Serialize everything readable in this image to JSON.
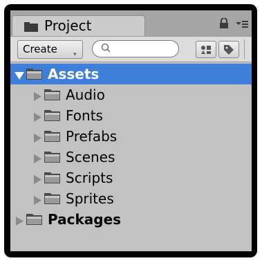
{
  "panel": {
    "tab_label": "Project",
    "tab_icon": "folder-tab-icon",
    "lock_icon": "lock-icon",
    "menu_icon": "menu-icon"
  },
  "toolbar": {
    "create_label": "Create",
    "create_arrow": "▾",
    "search_value": "",
    "search_placeholder": "",
    "filter_by_type_icon": "filter-by-type-icon",
    "filter_by_label_icon": "tag-icon"
  },
  "tree": {
    "root": {
      "label": "Assets",
      "expanded": true,
      "selected": true
    },
    "children": [
      {
        "label": "Audio"
      },
      {
        "label": "Fonts"
      },
      {
        "label": "Prefabs"
      },
      {
        "label": "Scenes"
      },
      {
        "label": "Scripts"
      },
      {
        "label": "Sprites"
      }
    ],
    "packages": {
      "label": "Packages",
      "expanded": false
    }
  },
  "colors": {
    "selection": "#3d7fd9",
    "panel_bg": "#c2c2c2",
    "tab_strip": "#a5a5a5"
  }
}
